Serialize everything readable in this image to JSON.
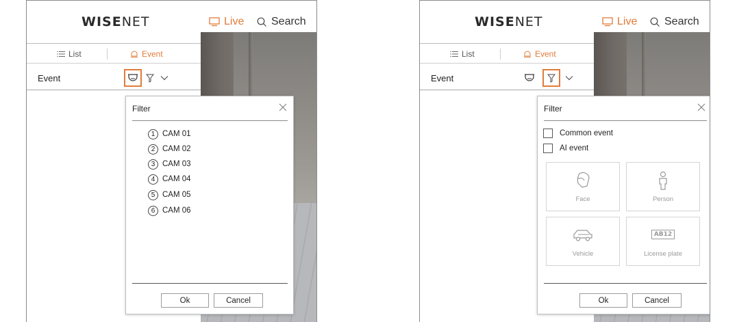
{
  "app": {
    "logo_bold": "WISE",
    "logo_thin": "NET"
  },
  "nav": {
    "live": "Live",
    "search": "Search"
  },
  "tabs": {
    "list": "List",
    "event": "Event"
  },
  "event_row": {
    "label": "Event"
  },
  "left_dialog": {
    "title": "Filter",
    "cameras": [
      {
        "num": "1",
        "label": "CAM 01"
      },
      {
        "num": "2",
        "label": "CAM 02"
      },
      {
        "num": "3",
        "label": "CAM 03"
      },
      {
        "num": "4",
        "label": "CAM 04"
      },
      {
        "num": "5",
        "label": "CAM 05"
      },
      {
        "num": "6",
        "label": "CAM 06"
      }
    ],
    "ok": "Ok",
    "cancel": "Cancel"
  },
  "right_dialog": {
    "title": "Filter",
    "common_event": "Common event",
    "ai_event": "AI event",
    "tiles": [
      {
        "label": "Face",
        "icon": "face-icon"
      },
      {
        "label": "Person",
        "icon": "person-icon"
      },
      {
        "label": "Vehicle",
        "icon": "vehicle-icon"
      },
      {
        "label": "License plate",
        "icon": "license-plate-icon",
        "badge": "AB12"
      }
    ],
    "ok": "Ok",
    "cancel": "Cancel"
  },
  "colors": {
    "accent": "#e07b39",
    "border": "#8a8a8a"
  }
}
